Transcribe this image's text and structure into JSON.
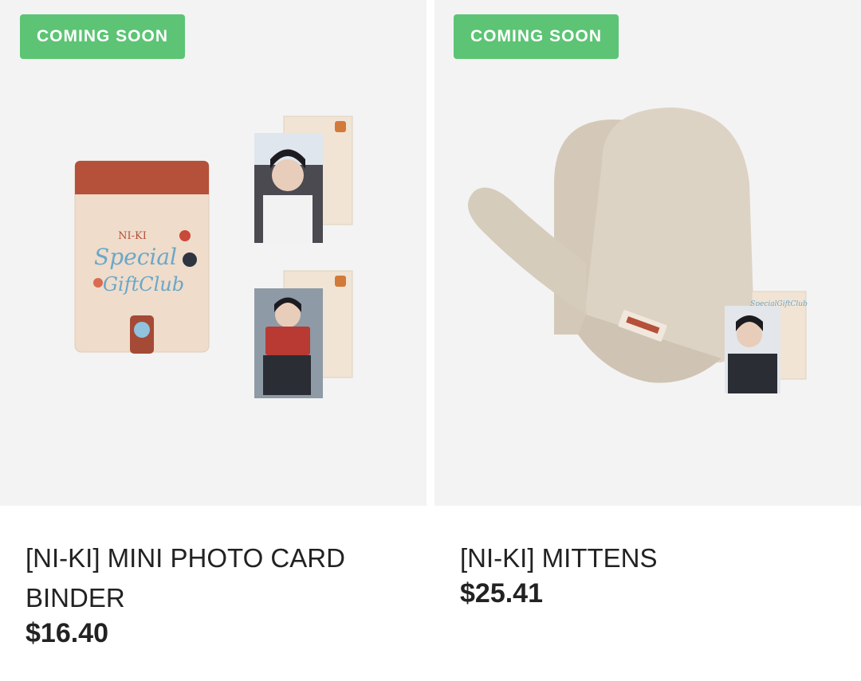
{
  "products": [
    {
      "badge": "COMING SOON",
      "title": "[NI-KI] MINI PHOTO CARD BINDER",
      "price": "$16.40",
      "image": {
        "binder_label_top": "NI-KI",
        "binder_label_main": "Special",
        "binder_label_sub": "GiftClub"
      }
    },
    {
      "badge": "COMING SOON",
      "title": "[NI-KI] MITTENS",
      "price": "$25.41",
      "image": {
        "card_label": "SpecialGiftClub"
      }
    }
  ],
  "colors": {
    "badge": "#5cc474",
    "image_bg": "#f3f3f4",
    "binder_body": "#efdccb",
    "binder_top": "#b5503a",
    "mitten": "#d9cfc0"
  }
}
